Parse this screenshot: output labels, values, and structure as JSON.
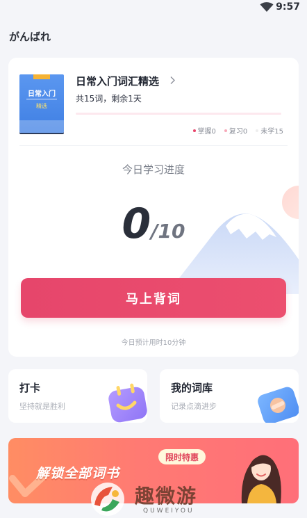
{
  "status_bar": {
    "time": "9:57"
  },
  "app": {
    "title": "がんばれ"
  },
  "book": {
    "cover_title": "日常入门",
    "cover_sub": "精选",
    "title": "日常入门词汇精选",
    "subtitle": "共15词，剩余1天",
    "progress": 0,
    "legend": [
      {
        "label": "掌握0",
        "color": "#e8466b"
      },
      {
        "label": "复习0",
        "color": "#f7a9b9"
      },
      {
        "label": "未学15",
        "color": "#eeeeee"
      }
    ]
  },
  "today": {
    "heading": "今日学习进度",
    "done": "0",
    "total": "/10",
    "button_label": "马上背词",
    "time_hint": "今日预计用时10分钟"
  },
  "checkin": {
    "title": "打卡",
    "subtitle": "坚持就是胜利"
  },
  "wordbank": {
    "title": "我的词库",
    "subtitle": "记录点滴进步"
  },
  "banner": {
    "title": "解锁全部词书",
    "badge": "限时特惠"
  },
  "watermark": {
    "text": "趣微游",
    "sub": "QUWEIYOU"
  }
}
